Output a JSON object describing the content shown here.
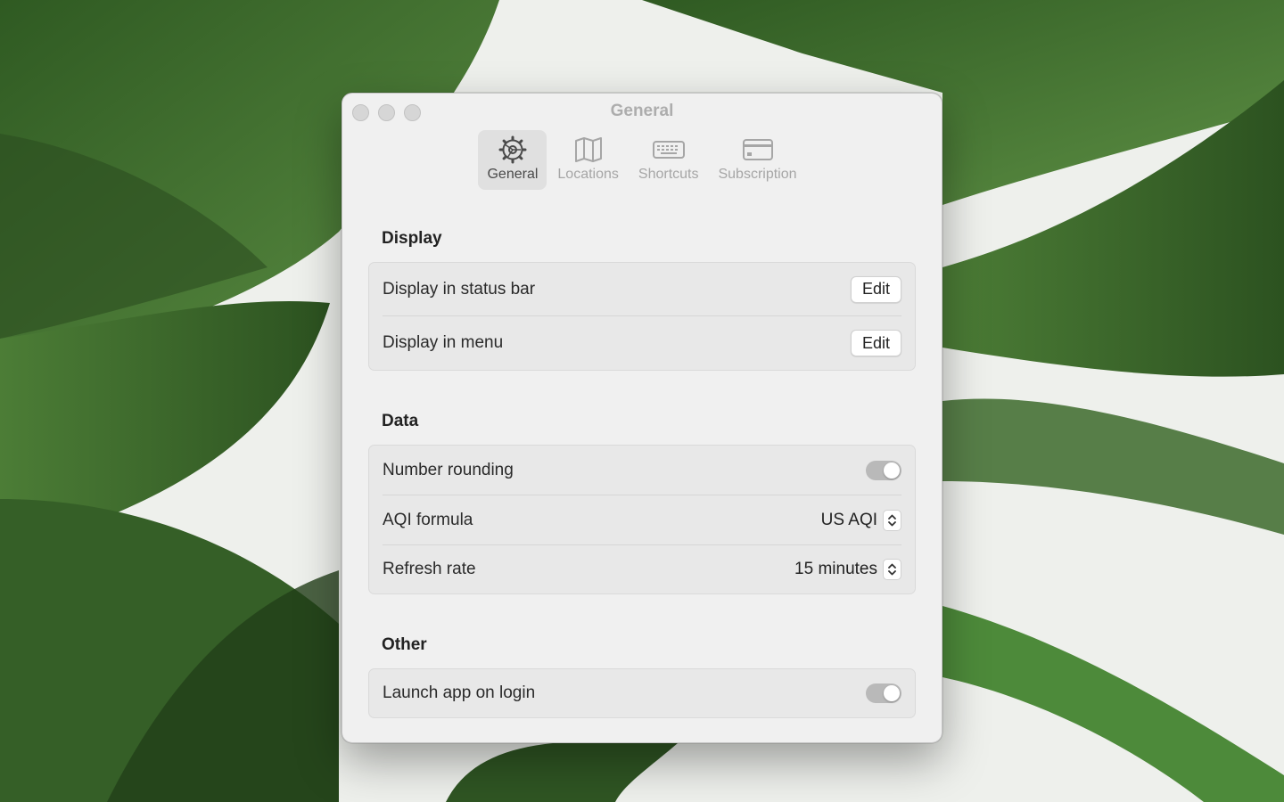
{
  "window": {
    "title": "General"
  },
  "toolbar": {
    "tabs": [
      {
        "label": "General",
        "icon": "gear-icon",
        "active": true
      },
      {
        "label": "Locations",
        "icon": "map-icon",
        "active": false
      },
      {
        "label": "Shortcuts",
        "icon": "keyboard-icon",
        "active": false
      },
      {
        "label": "Subscription",
        "icon": "credit-card-icon",
        "active": false
      }
    ]
  },
  "display": {
    "heading": "Display",
    "status_bar_label": "Display in status bar",
    "status_bar_button": "Edit",
    "menu_label": "Display in menu",
    "menu_button": "Edit"
  },
  "data": {
    "heading": "Data",
    "rounding_label": "Number rounding",
    "rounding_on": true,
    "aqi_label": "AQI formula",
    "aqi_value": "US AQI",
    "refresh_label": "Refresh rate",
    "refresh_value": "15 minutes"
  },
  "other": {
    "heading": "Other",
    "launch_label": "Launch app on login",
    "launch_on": true
  },
  "colors": {
    "window_bg": "#f0f0f0",
    "group_bg": "#e8e8e8",
    "toggle_track": "#b9b9b9",
    "wallpaper_leaf": "#3f6b2e",
    "wallpaper_bg": "#eef0ec"
  }
}
